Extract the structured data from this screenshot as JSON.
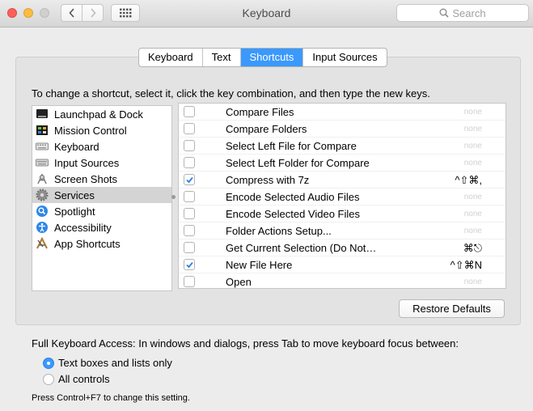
{
  "window": {
    "title": "Keyboard"
  },
  "search": {
    "placeholder": "Search"
  },
  "tabs": [
    {
      "label": "Keyboard",
      "active": false
    },
    {
      "label": "Text",
      "active": false
    },
    {
      "label": "Shortcuts",
      "active": true
    },
    {
      "label": "Input Sources",
      "active": false
    }
  ],
  "instructions": "To change a shortcut, select it, click the key combination, and then type the new keys.",
  "categories": [
    {
      "label": "Launchpad & Dock",
      "icon": "launchpad-icon"
    },
    {
      "label": "Mission Control",
      "icon": "mission-control-icon"
    },
    {
      "label": "Keyboard",
      "icon": "keyboard-icon"
    },
    {
      "label": "Input Sources",
      "icon": "input-sources-icon"
    },
    {
      "label": "Screen Shots",
      "icon": "screenshot-icon"
    },
    {
      "label": "Services",
      "icon": "services-gear-icon",
      "selected": true
    },
    {
      "label": "Spotlight",
      "icon": "spotlight-icon"
    },
    {
      "label": "Accessibility",
      "icon": "accessibility-icon"
    },
    {
      "label": "App Shortcuts",
      "icon": "app-shortcuts-icon"
    }
  ],
  "shortcuts": [
    {
      "name": "Compare Files",
      "checked": false,
      "key": "none"
    },
    {
      "name": "Compare Folders",
      "checked": false,
      "key": "none"
    },
    {
      "name": "Select Left File for Compare",
      "checked": false,
      "key": "none"
    },
    {
      "name": "Select Left Folder for Compare",
      "checked": false,
      "key": "none"
    },
    {
      "name": "Compress with 7z",
      "checked": true,
      "key": "^⇧⌘,"
    },
    {
      "name": "Encode Selected Audio Files",
      "checked": false,
      "key": "none"
    },
    {
      "name": "Encode Selected Video Files",
      "checked": false,
      "key": "none"
    },
    {
      "name": "Folder Actions Setup...",
      "checked": false,
      "key": "none"
    },
    {
      "name": "Get Current Selection (Do Not…",
      "checked": false,
      "key": "⌘⎋"
    },
    {
      "name": "New File Here",
      "checked": true,
      "key": "^⇧⌘N"
    },
    {
      "name": "Open",
      "checked": false,
      "key": "none"
    }
  ],
  "restore_label": "Restore Defaults",
  "full_keyboard_access": {
    "label": "Full Keyboard Access: In windows and dialogs, press Tab to move keyboard focus between:",
    "options": [
      {
        "label": "Text boxes and lists only",
        "selected": true
      },
      {
        "label": "All controls",
        "selected": false
      }
    ],
    "hint": "Press Control+F7 to change this setting."
  },
  "colors": {
    "accent": "#3b99fc",
    "selection": "#d4d4d4"
  }
}
